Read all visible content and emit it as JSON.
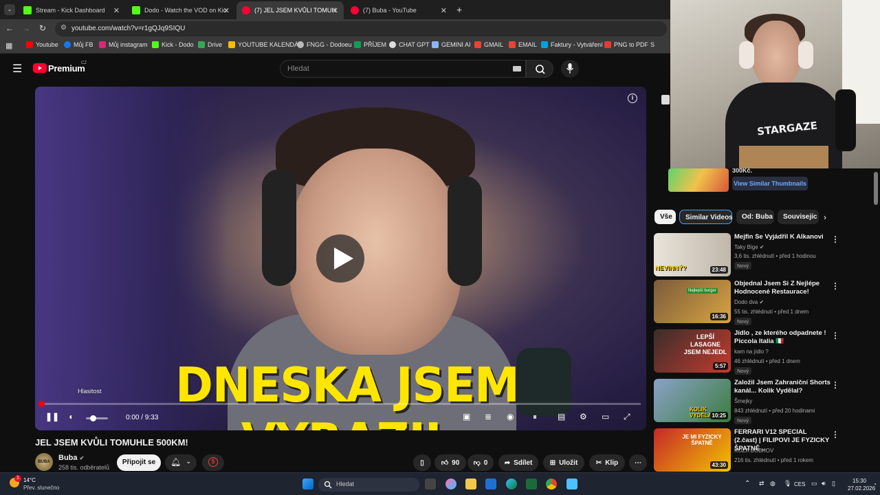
{
  "tabs": [
    {
      "label": "Stream - Kick Dashboard",
      "color": "#53fc18",
      "active": false
    },
    {
      "label": "Dodo - Watch the VOD on Kick",
      "color": "#53fc18",
      "active": false
    },
    {
      "label": "(7) JEL JSEM KVŮLI TOMUH",
      "color": "#ff0033",
      "active": true
    },
    {
      "label": "(7) Buba - YouTube",
      "color": "#ff0033",
      "active": false
    }
  ],
  "address": {
    "url": "youtube.com/watch?v=r1gQJq9SIQU"
  },
  "bookmarks": [
    {
      "label": "Youtube",
      "color": "#ff0000"
    },
    {
      "label": "Můj FB",
      "color": "#1877f2"
    },
    {
      "label": "Můj instagram",
      "color": "#d62976"
    },
    {
      "label": "Kick - Dodo",
      "color": "#53fc18"
    },
    {
      "label": "Drive",
      "color": "#34a853"
    },
    {
      "label": "YOUTUBE KALENDÁŘ",
      "color": "#fbbc04"
    },
    {
      "label": "FNGG - Dodoeu",
      "color": "#bbbbbb"
    },
    {
      "label": "PŘÍJEM",
      "color": "#0f9d58"
    },
    {
      "label": "CHAT GPT",
      "color": "#dddddd"
    },
    {
      "label": "GEMINI AI",
      "color": "#8ab4f8"
    },
    {
      "label": "GMAIL",
      "color": "#ea4335"
    },
    {
      "label": "EMAIL",
      "color": "#ea4335"
    },
    {
      "label": "Faktury - Vytváření",
      "color": "#00a3e0"
    },
    {
      "label": "PNG to PDF",
      "color": "#e53935"
    },
    {
      "label": "S",
      "color": "#ffffff"
    }
  ],
  "yt": {
    "brand": "Premium",
    "brand_region": "CZ",
    "search_placeholder": "Hledat"
  },
  "player": {
    "overlay_text": "DNESKA JSEM VYRAZIL",
    "volume_tooltip": "Hlasitost",
    "time": "0:00 / 9:33",
    "progress": 0.0,
    "volume_level": 0.3
  },
  "video": {
    "title": "JEL JSEM KVŮLI TOMUHLE 500KM!",
    "channel": "Buba",
    "channel_avatar_text": "BUBA",
    "subscribers": "258 tis. odběratelů",
    "join_label": "Připojit se",
    "likes": "90",
    "dislikes": "0",
    "share_label": "Sdílet",
    "save_label": "Uložit",
    "clip_label": "Klip"
  },
  "promo": {
    "fragment": "300Kč.",
    "button": "View Similar Thumbnails"
  },
  "chips": [
    {
      "label": "Vše",
      "active": true
    },
    {
      "label": "Similar Videos",
      "active": false
    },
    {
      "label": "Od: Buba",
      "active": false
    },
    {
      "label": "Souvisejíc",
      "active": false
    }
  ],
  "recommendations": [
    {
      "title": "Mejfin Se Vyjádřil K Alkanovi",
      "channel": "Taky Bige",
      "meta": "3,6 tis. zhlédnutí • před 1 hodinou",
      "badge": "Nový",
      "duration": "23:48",
      "thumb_text": "NEVINNÝ?",
      "colors": [
        "#e9e4da",
        "#c9c3b7"
      ]
    },
    {
      "title": "Objednal Jsem Si Z Nejlépe Hodnocené Restaurace!",
      "channel": "Dodo dva",
      "meta": "55 tis. zhlédnutí • před 1 dnem",
      "badge": "Nový",
      "duration": "16:36",
      "thumb_text": "Nejlepší burger",
      "colors": [
        "#7a5b3c",
        "#d9a441"
      ]
    },
    {
      "title": "Jídlo , ze kterého odpadnete ! Piccola Italia 🇮🇹",
      "channel": "kam na jídlo ?",
      "meta": "46 zhlédnutí • před 1 dnem",
      "badge": "Nový",
      "duration": "5:57",
      "thumb_text": "LEPŠÍ LASAGNE JSEM NEJEDL",
      "colors": [
        "#3a2e2a",
        "#c43a2f"
      ]
    },
    {
      "title": "Založil Jsem Zahraniční Shorts kanál... Kolik Vydělal?",
      "channel": "Šmejky",
      "meta": "843 zhlédnutí • před 20 hodinami",
      "badge": "Nový",
      "duration": "10:25",
      "thumb_text": "KOLIK VYDĚLAL",
      "colors": [
        "#8aa2c9",
        "#3b7d3e"
      ]
    },
    {
      "title": "FERRARI V12 SPECIAL (2.čast) | FILIPOVI JE FYZICKY ŠPATNĚ ...",
      "channel": "KOZA BOBKOV",
      "meta": "216 tis. zhlédnutí • před 1 rokem",
      "badge": "",
      "duration": "43:30",
      "thumb_text": "JE MI FYZICKY ŠPATNĚ",
      "colors": [
        "#c62828",
        "#f2c200"
      ]
    }
  ],
  "taskbar": {
    "temp": "14°C",
    "weather": "Přev. slunečno",
    "notif": "1",
    "search": "Hledat",
    "lang": "CES",
    "time": "15:30",
    "date": "27.02.2026"
  }
}
